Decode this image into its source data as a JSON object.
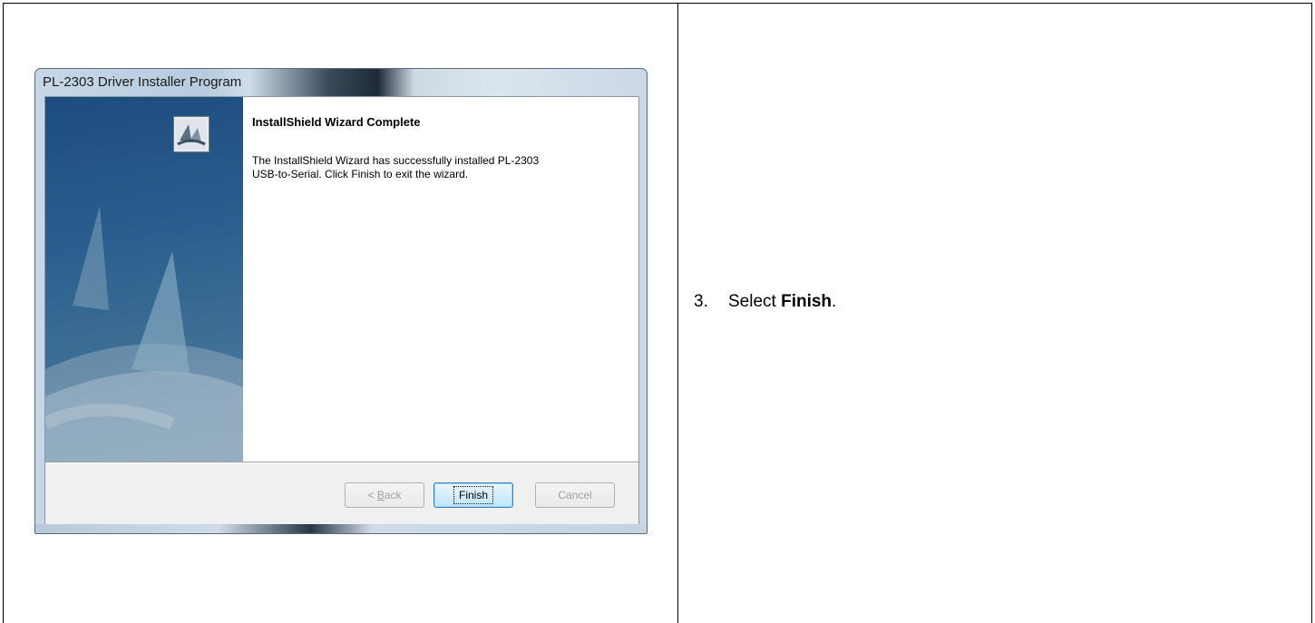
{
  "window": {
    "title": "PL-2303 Driver Installer Program"
  },
  "wizard": {
    "heading": "InstallShield Wizard Complete",
    "message": "The InstallShield Wizard has successfully installed PL-2303\nUSB-to-Serial.  Click Finish to exit the wizard.",
    "logo_icon": "installshield-logo-icon",
    "buttons": {
      "back_prefix": "< ",
      "back_mnemonic": "B",
      "back_rest": "ack",
      "finish": "Finish",
      "cancel": "Cancel"
    }
  },
  "instruction": {
    "number": "3.",
    "prefix": "Select ",
    "bold_word": "Finish",
    "suffix": "."
  },
  "colors": {
    "art_dark": "#1d4c7e",
    "art_light": "#6a8fa8",
    "default_button_border": "#3c7fb1"
  }
}
